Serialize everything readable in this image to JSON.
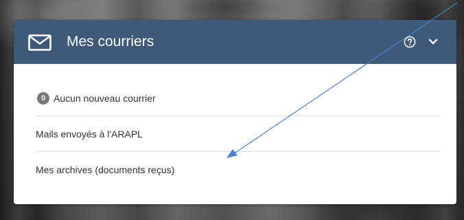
{
  "widget": {
    "title": "Mes courriers",
    "header_color": "#3f5a78",
    "icons": {
      "title_icon": "envelope-icon",
      "help": "question-circle-icon",
      "toggle": "chevron-down-icon"
    }
  },
  "mail_list": {
    "items": [
      {
        "badge": "0",
        "label": "Aucun nouveau courrier"
      },
      {
        "label": "Mails envoyés à l'ARAPL"
      },
      {
        "label": "Mes archives (documents reçus)"
      }
    ]
  },
  "annotation": {
    "arrow_color": "#4a7fd1"
  }
}
